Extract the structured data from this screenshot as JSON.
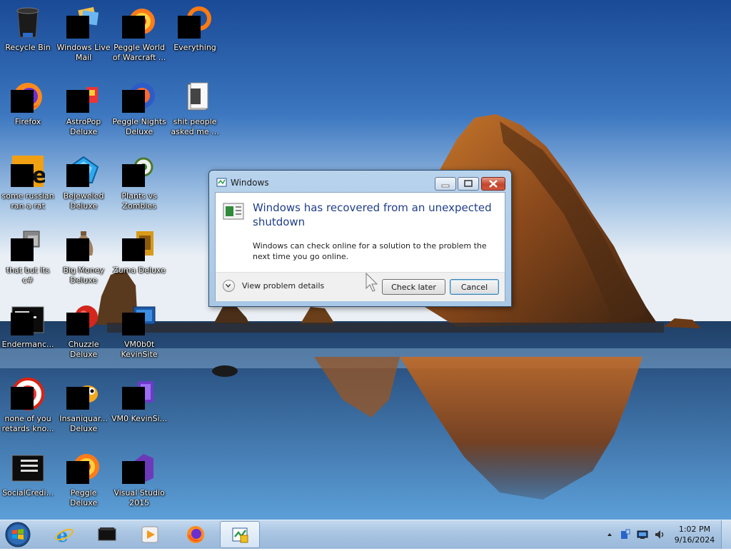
{
  "desktop_icons": [
    {
      "label": "Recycle Bin",
      "icon": "recycle-bin-icon"
    },
    {
      "label": "Windows Live Mail",
      "icon": "windows-live-mail-icon"
    },
    {
      "label": "Peggle World of Warcraft ...",
      "icon": "peggle-icon"
    },
    {
      "label": "Everything",
      "icon": "everything-search-icon"
    },
    {
      "label": "Firefox",
      "icon": "firefox-icon"
    },
    {
      "label": "AstroPop Deluxe",
      "icon": "astropop-icon"
    },
    {
      "label": "Peggle Nights Deluxe",
      "icon": "peggle-nights-icon"
    },
    {
      "label": "shit people asked me ...",
      "icon": "folder-icon"
    },
    {
      "label": "some russian ran a rat",
      "icon": "shortcut-icon"
    },
    {
      "label": "Bejeweled Deluxe",
      "icon": "bejeweled-icon"
    },
    {
      "label": "Plants vs Zombies",
      "icon": "plants-vs-zombies-icon"
    },
    {
      "label": "that but its c#",
      "icon": "shortcut-icon"
    },
    {
      "label": "Big Money Deluxe",
      "icon": "money-bag-icon"
    },
    {
      "label": "Zuma Deluxe",
      "icon": "zuma-icon"
    },
    {
      "label": "Endermanc...",
      "icon": "console-icon"
    },
    {
      "label": "Chuzzle Deluxe",
      "icon": "chuzzle-icon"
    },
    {
      "label": "VM0b0t KevinSite",
      "icon": "vm-icon"
    },
    {
      "label": "none of you retards kno...",
      "icon": "shortcut-icon"
    },
    {
      "label": "Insaniquar... Deluxe",
      "icon": "insaniquarium-icon"
    },
    {
      "label": "VM0 KevinSi...",
      "icon": "vm-icon"
    },
    {
      "label": "SocialCredi...",
      "icon": "console-icon"
    },
    {
      "label": "Peggle Deluxe",
      "icon": "peggle-icon"
    },
    {
      "label": "Visual Studio 2015",
      "icon": "visual-studio-icon"
    }
  ],
  "dialog": {
    "title": "Windows",
    "heading": "Windows has recovered from an unexpected shutdown",
    "body": "Windows can check online for a solution to the problem the next time you go online.",
    "details_label": "View problem details",
    "check_later_label": "Check later",
    "cancel_label": "Cancel",
    "caption_buttons": [
      "minimize-icon",
      "maximize-icon",
      "close-icon"
    ]
  },
  "taskbar": {
    "pinned": [
      "internet-explorer-icon",
      "terminal-icon",
      "media-player-icon",
      "firefox-icon",
      "problem-reports-icon"
    ],
    "active_index": 4,
    "tray_icons": [
      "show-hidden-icons-icon",
      "action-center-icon",
      "network-icon",
      "volume-icon"
    ],
    "clock_time": "1:02 PM",
    "clock_date": "9/16/2024"
  },
  "colors": {
    "sky_top": "#1d4f9a",
    "sky_horizon": "#e6eef6",
    "taskbar": "#b2cbe6",
    "dialog_heading": "#1f3e8a"
  }
}
